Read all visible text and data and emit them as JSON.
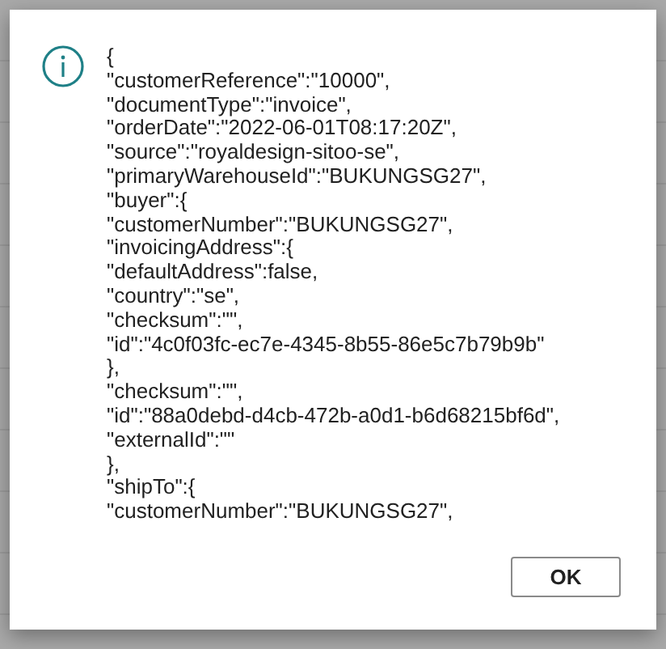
{
  "dialog": {
    "kind": "info",
    "message_lines": [
      "{",
      "\"customerReference\":\"10000\",",
      "\"documentType\":\"invoice\",",
      "\"orderDate\":\"2022-06-01T08:17:20Z\",",
      "\"source\":\"royaldesign-sitoo-se\",",
      "\"primaryWarehouseId\":\"BUKUNGSG27\",",
      "\"buyer\":{",
      "\"customerNumber\":\"BUKUNGSG27\",",
      "\"invoicingAddress\":{",
      "\"defaultAddress\":false,",
      "\"country\":\"se\",",
      "\"checksum\":\"\",",
      "\"id\":\"4c0f03fc-ec7e-4345-8b55-86e5c7b79b9b\"",
      "},",
      "\"checksum\":\"\",",
      "\"id\":\"88a0debd-d4cb-472b-a0d1-b6d68215bf6d\",",
      "\"externalId\":\"\"",
      "},",
      "\"shipTo\":{",
      "\"customerNumber\":\"BUKUNGSG27\","
    ],
    "buttons": [
      "OK"
    ]
  }
}
